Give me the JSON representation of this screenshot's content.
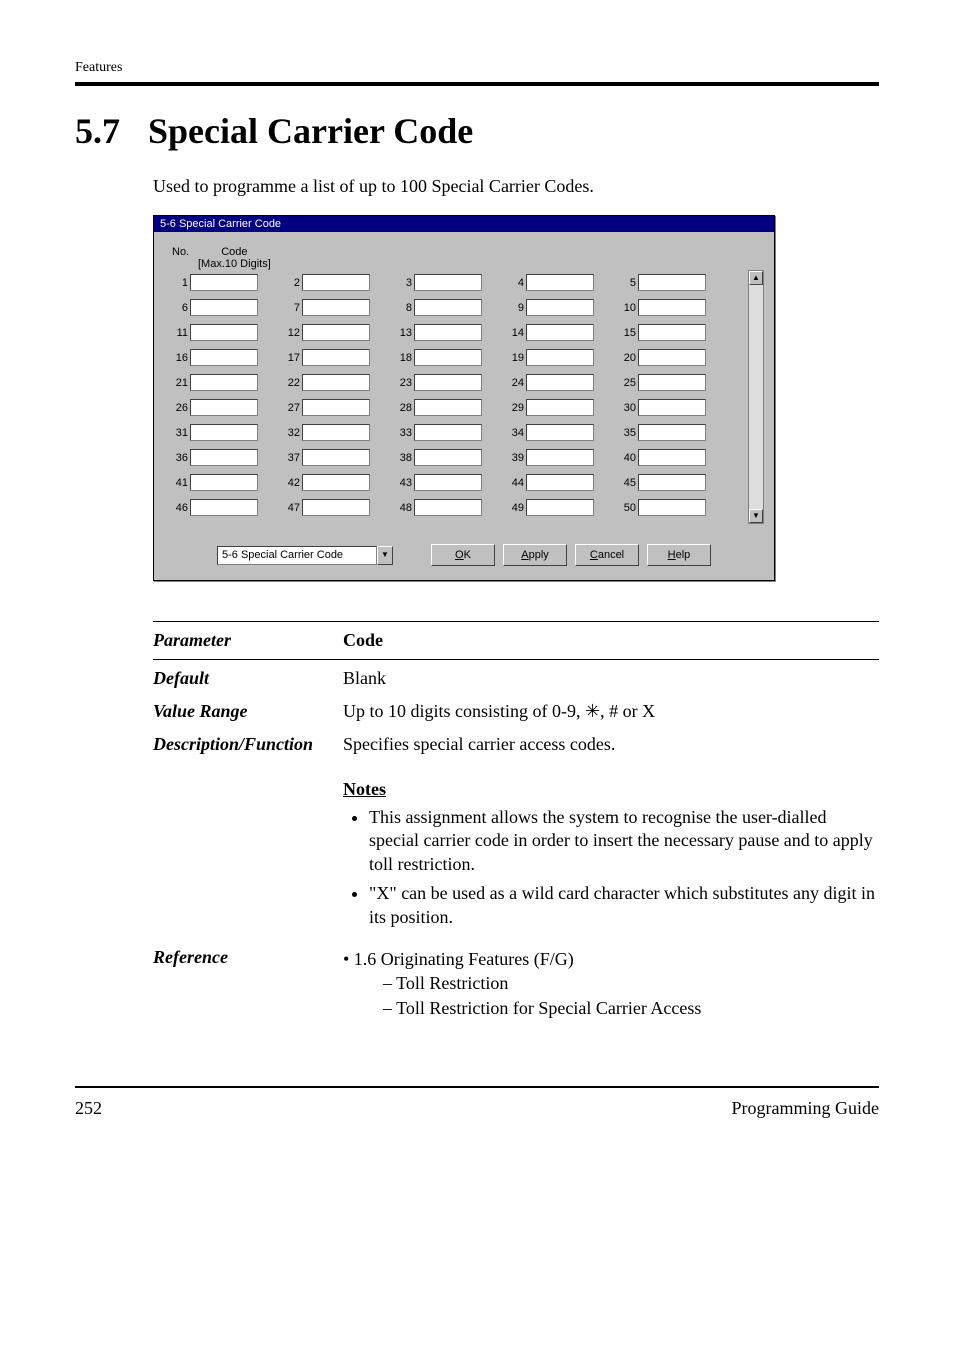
{
  "running_head": "Features",
  "section": {
    "number": "5.7",
    "title": "Special Carrier Code"
  },
  "intro": "Used to programme a list of up to 100 Special Carrier Codes.",
  "dialog": {
    "title": "5-6 Special Carrier Code",
    "header_no": "No.",
    "header_code1": "Code",
    "header_code2": "[Max.10 Digits]",
    "cell_nums": [
      "1",
      "2",
      "3",
      "4",
      "5",
      "6",
      "7",
      "8",
      "9",
      "10",
      "11",
      "12",
      "13",
      "14",
      "15",
      "16",
      "17",
      "18",
      "19",
      "20",
      "21",
      "22",
      "23",
      "24",
      "25",
      "26",
      "27",
      "28",
      "29",
      "30",
      "31",
      "32",
      "33",
      "34",
      "35",
      "36",
      "37",
      "38",
      "39",
      "40",
      "41",
      "42",
      "43",
      "44",
      "45",
      "46",
      "47",
      "48",
      "49",
      "50"
    ],
    "scroll_up_glyph": "▲",
    "scroll_down_glyph": "▼",
    "nav_combo": "5-6 Special Carrier Code",
    "dd_glyph": "▼",
    "btn_ok_u": "O",
    "btn_ok_rest": "K",
    "btn_apply_u": "A",
    "btn_apply_rest": "pply",
    "btn_cancel_u": "C",
    "btn_cancel_rest": "ancel",
    "btn_help_u": "H",
    "btn_help_rest": "elp"
  },
  "param": {
    "labels": {
      "parameter": "Parameter",
      "default": "Default",
      "value_range": "Value Range",
      "desc_fn": "Description/Function",
      "reference": "Reference"
    },
    "code_label": "Code",
    "default_val": "Blank",
    "value_range": "Up to 10 digits consisting of 0-9, ✳, # or X",
    "desc_fn": "Specifies special carrier access codes.",
    "notes_head": "Notes",
    "note1": "This assignment allows the system to recognise the user-dialled special carrier code in order to insert the necessary pause and to apply toll restriction.",
    "note2": "\"X\" can be used as a wild card character which substitutes any digit in its position.",
    "ref_line1": "• 1.6 Originating Features (F/G)",
    "ref_line2": "– Toll Restriction",
    "ref_line3": "– Toll Restriction for Special Carrier Access"
  },
  "footer": {
    "page": "252",
    "title": "Programming Guide"
  }
}
